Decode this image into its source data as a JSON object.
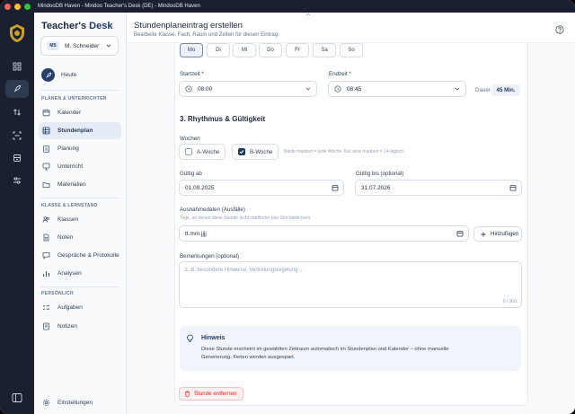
{
  "window": {
    "title": "MindooDB Haven - Mindoo Teacher's Desk (DE) - MindooDB Haven"
  },
  "brand": {
    "part1": "Teacher's ",
    "part2": "Desk"
  },
  "user": {
    "initials": "MS",
    "name": "M. Schneider"
  },
  "sidebar": {
    "today_label": "Heute",
    "sections": [
      {
        "header": "PLANEN & UNTERRICHTEN",
        "items": [
          "Kalender",
          "Stundenplan",
          "Planung",
          "Unterricht",
          "Materialien"
        ]
      },
      {
        "header": "KLASSE & LERNSTAND",
        "items": [
          "Klassen",
          "Noten",
          "Gespräche & Protokolle",
          "Analysen"
        ]
      },
      {
        "header": "PERSÖNLICH",
        "items": [
          "Aufgaben",
          "Notizen"
        ]
      }
    ],
    "active_item": "Stundenplan",
    "settings_label": "Einstellungen"
  },
  "header": {
    "title": "Stundenplaneintrag erstellen",
    "subtitle": "Bearbeite Klasse, Fach, Raum und Zeiten für diesen Eintrag."
  },
  "days": [
    "Mo",
    "Di",
    "Mi",
    "Do",
    "Fr",
    "Sa",
    "So"
  ],
  "selected_day": "Mo",
  "time": {
    "start_label": "Startzeit *",
    "start_value": "08:00",
    "end_label": "Endzeit *",
    "end_value": "08:45",
    "duration_label": "Dauer",
    "duration_value": "45 Min."
  },
  "rhythm": {
    "title": "3. Rhythmus & Gültigkeit",
    "weeks_label": "Wochen",
    "a_week": {
      "label": "A-Woche",
      "checked": false
    },
    "b_week": {
      "label": "B-Woche",
      "checked": true
    },
    "weeks_hint": "Beide markiert = jede Woche. Nur eine markiert = 14-täglich.",
    "valid_from_label": "Gültig ab",
    "valid_from_value": "01.09.2025",
    "valid_to_label": "Gültig bis (optional)",
    "valid_to_value": "31.07.2026",
    "exceptions_label": "Ausnahmedaten (Ausfälle)",
    "exceptions_hint": "Tage, an denen diese Stunde nicht stattfindet (der Slot bleibt leer).",
    "exceptions_placeholder": "tt.mm.jjjj",
    "add_label": "Hinzufügen",
    "notes_label": "Bemerkungen (optional)",
    "notes_placeholder": "z. B. besondere Hinweise, Vertretungsregelung ...",
    "notes_counter": "0 / 300"
  },
  "info": {
    "title": "Hinweis",
    "text_line1": "Diese Stunde erscheint im gewählten Zeitraum automatisch im Stundenplan und Kalender – ohne manuelle",
    "text_line2": "Generierung. Ferien werden ausgespart."
  },
  "remove_label": "Stunde entfernen",
  "colors": {
    "primary": "#1e3a5f",
    "rail": "#1a2030",
    "danger": "#dc2626"
  }
}
